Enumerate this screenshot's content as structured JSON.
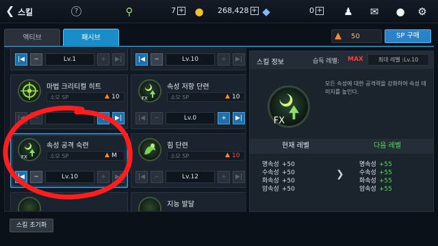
{
  "header": {
    "back_icon": "chevron-left-icon",
    "title": "스킬",
    "help": "?",
    "energy_value": "7",
    "gold_value": "268,428",
    "gem_value": "0"
  },
  "tabs": [
    {
      "label": "액티브"
    },
    {
      "label": "패시브"
    }
  ],
  "sp": {
    "value": "50",
    "buy_label": "SP 구매"
  },
  "skills": [
    {
      "name": "",
      "cost_label": "",
      "cost_value": "",
      "level": "Lv.1"
    },
    {
      "name": "",
      "cost_label": "",
      "cost_value": "",
      "level": "Lv.10"
    },
    {
      "name": "마법 크리티컬 히트",
      "cost_label": "소모 SP",
      "cost_value": "10",
      "level": ""
    },
    {
      "name": "속성 저항 단련",
      "cost_label": "소모 SP",
      "cost_value": "10",
      "level": "Lv.0"
    },
    {
      "name": "속성 공격 숙련",
      "cost_label": "소모 SP",
      "cost_value": "M",
      "level": "Lv.10"
    },
    {
      "name": "힘 단련",
      "cost_label": "소모 SP",
      "cost_value": "10",
      "level": "Lv.12"
    },
    {
      "name": "",
      "cost_label": "",
      "cost_value": "",
      "level": ""
    },
    {
      "name": "지능 발달",
      "cost_label": "",
      "cost_value": "",
      "level": ""
    }
  ],
  "info": {
    "title": "스킬 정보",
    "learn_level_label": "습득 레벨:",
    "learn_level_value": "MAX",
    "max_level": "최대 레벨 :Lv.10",
    "description": "모든 속성에 대한 공격력을 강화하여 속성 데미지를 높인다.",
    "current_level_label": "현재 레벨",
    "next_level_label": "다음 레벨",
    "current_stats": [
      {
        "name": "명속성",
        "value": "+50"
      },
      {
        "name": "수속성",
        "value": "+50"
      },
      {
        "name": "화속성",
        "value": "+50"
      },
      {
        "name": "암속성",
        "value": "+50"
      }
    ],
    "next_stats": [
      {
        "name": "명속성",
        "value": "+55"
      },
      {
        "name": "수속성",
        "value": "+55"
      },
      {
        "name": "화속성",
        "value": "+55"
      },
      {
        "name": "암속성",
        "value": "+55"
      }
    ]
  },
  "reset_label": "스킬 초기화",
  "colors": {
    "accent": "#1a8cc7",
    "max": "#ff3c3c",
    "next": "#4fe34f",
    "annotation": "#ff1e1e"
  }
}
